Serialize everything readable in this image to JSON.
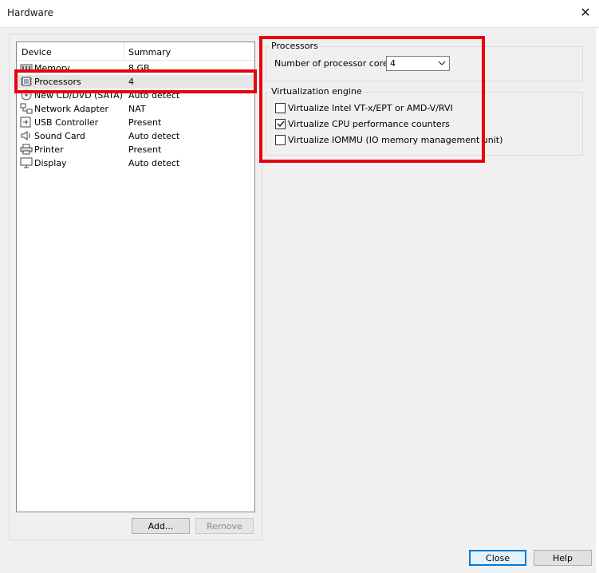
{
  "window": {
    "title": "Hardware",
    "close_glyph": "✕"
  },
  "device_list": {
    "columns": {
      "device": "Device",
      "summary": "Summary"
    },
    "rows": [
      {
        "name": "Memory",
        "summary": "8 GB",
        "icon": "memory-icon"
      },
      {
        "name": "Processors",
        "summary": "4",
        "icon": "processor-icon",
        "selected": true
      },
      {
        "name": "New CD/DVD (SATA)",
        "summary": "Auto detect",
        "icon": "cd-dvd-icon"
      },
      {
        "name": "Network Adapter",
        "summary": "NAT",
        "icon": "network-icon"
      },
      {
        "name": "USB Controller",
        "summary": "Present",
        "icon": "usb-icon"
      },
      {
        "name": "Sound Card",
        "summary": "Auto detect",
        "icon": "speaker-icon"
      },
      {
        "name": "Printer",
        "summary": "Present",
        "icon": "printer-icon"
      },
      {
        "name": "Display",
        "summary": "Auto detect",
        "icon": "monitor-icon"
      }
    ]
  },
  "buttons": {
    "add": "Add...",
    "remove": "Remove",
    "close": "Close",
    "help": "Help"
  },
  "processors": {
    "group_title": "Processors",
    "cores_label": "Number of processor cores:",
    "cores_value": "4"
  },
  "virtualization": {
    "group_title": "Virtualization engine",
    "options": [
      {
        "label": "Virtualize Intel VT-x/EPT or AMD-V/RVI",
        "checked": false
      },
      {
        "label": "Virtualize CPU performance counters",
        "checked": true
      },
      {
        "label": "Virtualize IOMMU (IO memory management unit)",
        "checked": false
      }
    ]
  },
  "colors": {
    "highlight_red": "#e8000f",
    "default_button_blue": "#0078d7"
  }
}
